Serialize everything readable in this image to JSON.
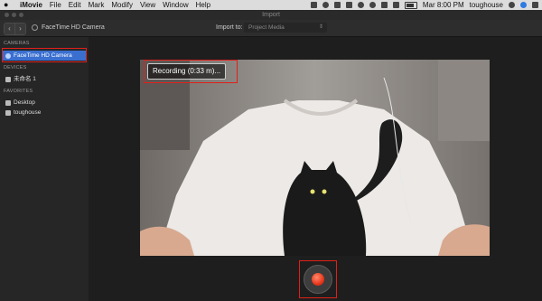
{
  "menubar": {
    "app": "iMovie",
    "items": [
      "File",
      "Edit",
      "Mark",
      "Modify",
      "View",
      "Window",
      "Help"
    ],
    "clock": "Mar 8:00 PM",
    "user": "toughouse"
  },
  "window": {
    "title": "Import"
  },
  "toolbar": {
    "camera_name": "FaceTime HD Camera",
    "import_label": "Import to:",
    "import_value": "Project Media"
  },
  "sidebar": {
    "cameras_title": "CAMERAS",
    "camera_item": "FaceTime HD Camera",
    "devices_title": "DEVICES",
    "device_item": "未命名 1",
    "favorites_title": "FAVORITES",
    "fav_items": [
      "Desktop",
      "toughouse"
    ]
  },
  "recording": {
    "status": "Recording (0:33 m)..."
  }
}
